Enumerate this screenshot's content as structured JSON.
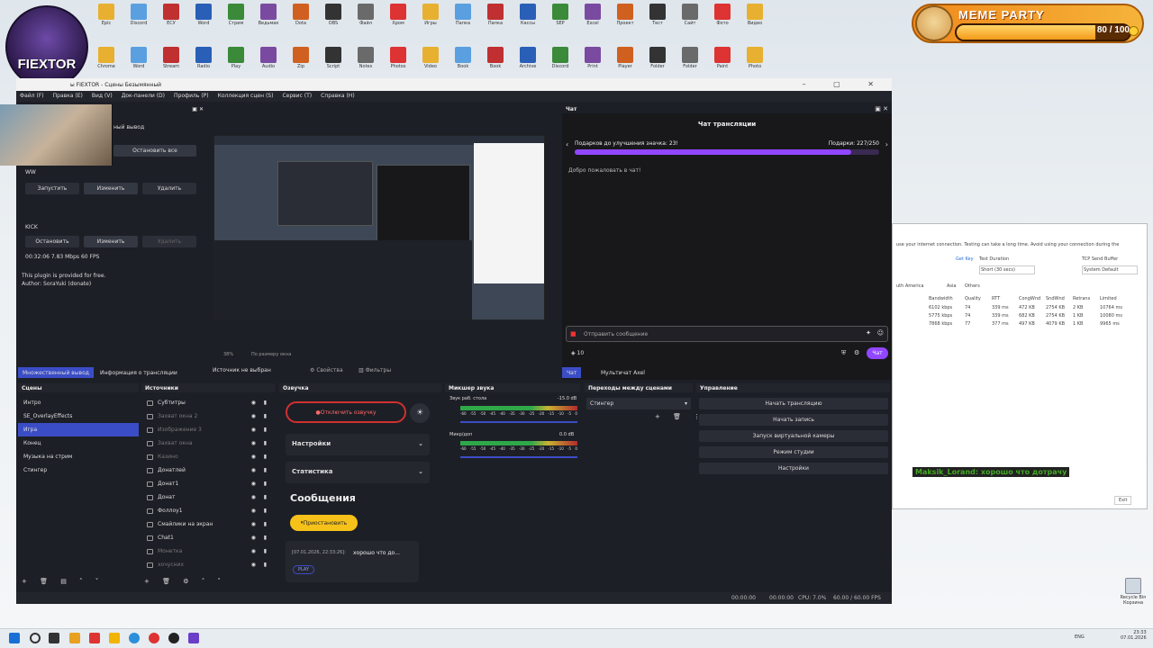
{
  "desktop": {
    "avatar_text": "FIEXTOR",
    "icons_row1": [
      "Epic",
      "Discord",
      "ЕСУ",
      "Word",
      "Стрим",
      "Ведьмак",
      "Dota",
      "OBS",
      "Файл",
      "Хром",
      "Игры",
      "Папка",
      "Папка",
      "Кассы",
      "SEP",
      "Excel",
      "Проект",
      "Тест",
      "Сайт",
      "Фото",
      "Видео"
    ],
    "icons_row2": [
      "Chrome",
      "Word",
      "Stream",
      "Radio",
      "Play",
      "Audio",
      "Zip",
      "Script",
      "Notes",
      "Photos",
      "Video",
      "Book",
      "Book",
      "Archive",
      "Discord",
      "Print",
      "Player",
      "Folder",
      "Folder",
      "Paint",
      "Photo"
    ],
    "right_icons": [
      "Recycle Bin Корзина"
    ],
    "meme": {
      "title": "MEME PARTY",
      "count": "80 / 100",
      "fill": 0.8
    },
    "speedtest": {
      "hint": "use your internet connection. Testing can take a long time. Avoid using your connection during the",
      "get_key": "Get Key",
      "test_duration": "Test Duration",
      "duration_value": "Short (30 secs)",
      "tcp_buffer": "TCP Send Buffer",
      "buffer_value": "System Default",
      "regions": [
        "uth America",
        "Asia",
        "Others"
      ],
      "headers": [
        "Bandwidth",
        "Quality",
        "RTT",
        "CongWnd",
        "SndWnd",
        "Retrans",
        "Limited"
      ],
      "rows": [
        [
          "6102 kbps",
          "74",
          "339 ms",
          "472 KB",
          "2754 KB",
          "2 KB",
          "10764 ms"
        ],
        [
          "5775 kbps",
          "74",
          "339 ms",
          "682 KB",
          "2754 KB",
          "1 KB",
          "10080 ms"
        ],
        [
          "7868 kbps",
          "77",
          "377 ms",
          "497 KB",
          "4079 KB",
          "1 KB",
          "9965 ms"
        ]
      ],
      "exit": "Exit",
      "chat_overlay": "Maksik_Lorand: хорошо что дотрачу"
    }
  },
  "obs": {
    "title": "ы FIEXTOR - Сцены Безымянный",
    "menu": [
      "Файл (F)",
      "Правка (E)",
      "Вид (V)",
      "Док-панели (D)",
      "Профиль (P)",
      "Коллекция сцен (S)",
      "Сервис (T)",
      "Справка (H)"
    ],
    "multi_output": {
      "label": "ный вывод",
      "stop_all": "Остановить все",
      "ww": "WW",
      "start": "Запустить",
      "edit": "Изменить",
      "delete": "Удалить",
      "kick": "KICK",
      "stop": "Остановить",
      "edit2": "Изменить",
      "delete2": "Удалить",
      "stats": "00:32:06  7.83 Mbps  60 FPS",
      "plugin": "This plugin is provided for free.",
      "author": "Author: SoraYuki (donate)"
    },
    "preview": {
      "zoom": "38%",
      "fit": "По размеру окна"
    },
    "tabs_left": [
      "Множественный вывод",
      "Информация о трансляции"
    ],
    "source_bar": {
      "label": "Источник не выбран",
      "props": "Свойства",
      "filters": "Фильтры"
    },
    "chat": {
      "panel": "Чат",
      "header": "Чат трансляции",
      "gift_left": "Подарков до улучшения значка: 23!",
      "gift_right": "Подарки: 227/250",
      "gift_fill": 0.908,
      "welcome": "Добро пожаловать в чат!",
      "placeholder": "Отправить сообщение",
      "points": "10",
      "send": "Чат",
      "tabs": [
        "Чат",
        "Мультичат Axel"
      ]
    },
    "scenes": {
      "title": "Сцены",
      "items": [
        "Интро",
        "SE_OverlayEffects",
        "Игра",
        "Конец",
        "Музыка на стрим",
        "Стингер"
      ],
      "selected": 2
    },
    "sources": {
      "title": "Источники",
      "items": [
        {
          "name": "Субтитры",
          "dim": false
        },
        {
          "name": "Захват окна 2",
          "dim": true
        },
        {
          "name": "Изображение 3",
          "dim": true
        },
        {
          "name": "Захват окна",
          "dim": true
        },
        {
          "name": "Казино",
          "dim": true
        },
        {
          "name": "Донатлей",
          "dim": false
        },
        {
          "name": "Донат1",
          "dim": false
        },
        {
          "name": "Донат",
          "dim": false
        },
        {
          "name": "Фоллоу1",
          "dim": false
        },
        {
          "name": "Смайлики на экран",
          "dim": false
        },
        {
          "name": "Chat1",
          "dim": false
        },
        {
          "name": "Монетка",
          "dim": true
        },
        {
          "name": "хочусних",
          "dim": true
        }
      ]
    },
    "voice": {
      "title": "Озвучка",
      "disable": "Отключить озвучку",
      "settings": "Настройки",
      "stats": "Статистика",
      "messages": "Сообщения",
      "pause": "Приостановить",
      "msg_time": "[07.01.2026, 22:33:26]:",
      "msg_text": "хорошо что до...",
      "play": "PLAY"
    },
    "mixer": {
      "title": "Микшер звука",
      "ch1": "Звук раб. стола",
      "ch1_db": "-15.0 dB",
      "ch2": "Микр/доп",
      "ch2_db": "0.0 dB",
      "ticks": [
        "-60",
        "-55",
        "-50",
        "-45",
        "-40",
        "-35",
        "-30",
        "-25",
        "-20",
        "-15",
        "-10",
        "-5",
        "0"
      ]
    },
    "transitions": {
      "title": "Переходы между сценами",
      "value": "Стингер"
    },
    "controls": {
      "title": "Управление",
      "buttons": [
        "Начать трансляцию",
        "Начать запись",
        "Запуск виртуальной камеры",
        "Режим студии",
        "Настройки"
      ]
    },
    "status": {
      "t1": "00:00:00",
      "t2": "00:00:00",
      "cpu": "CPU: 7.0%",
      "fps": "60.00 / 60.00 FPS"
    }
  },
  "taskbar": {
    "lang": "ENG",
    "time": "23:33",
    "date": "07.01.2026"
  }
}
